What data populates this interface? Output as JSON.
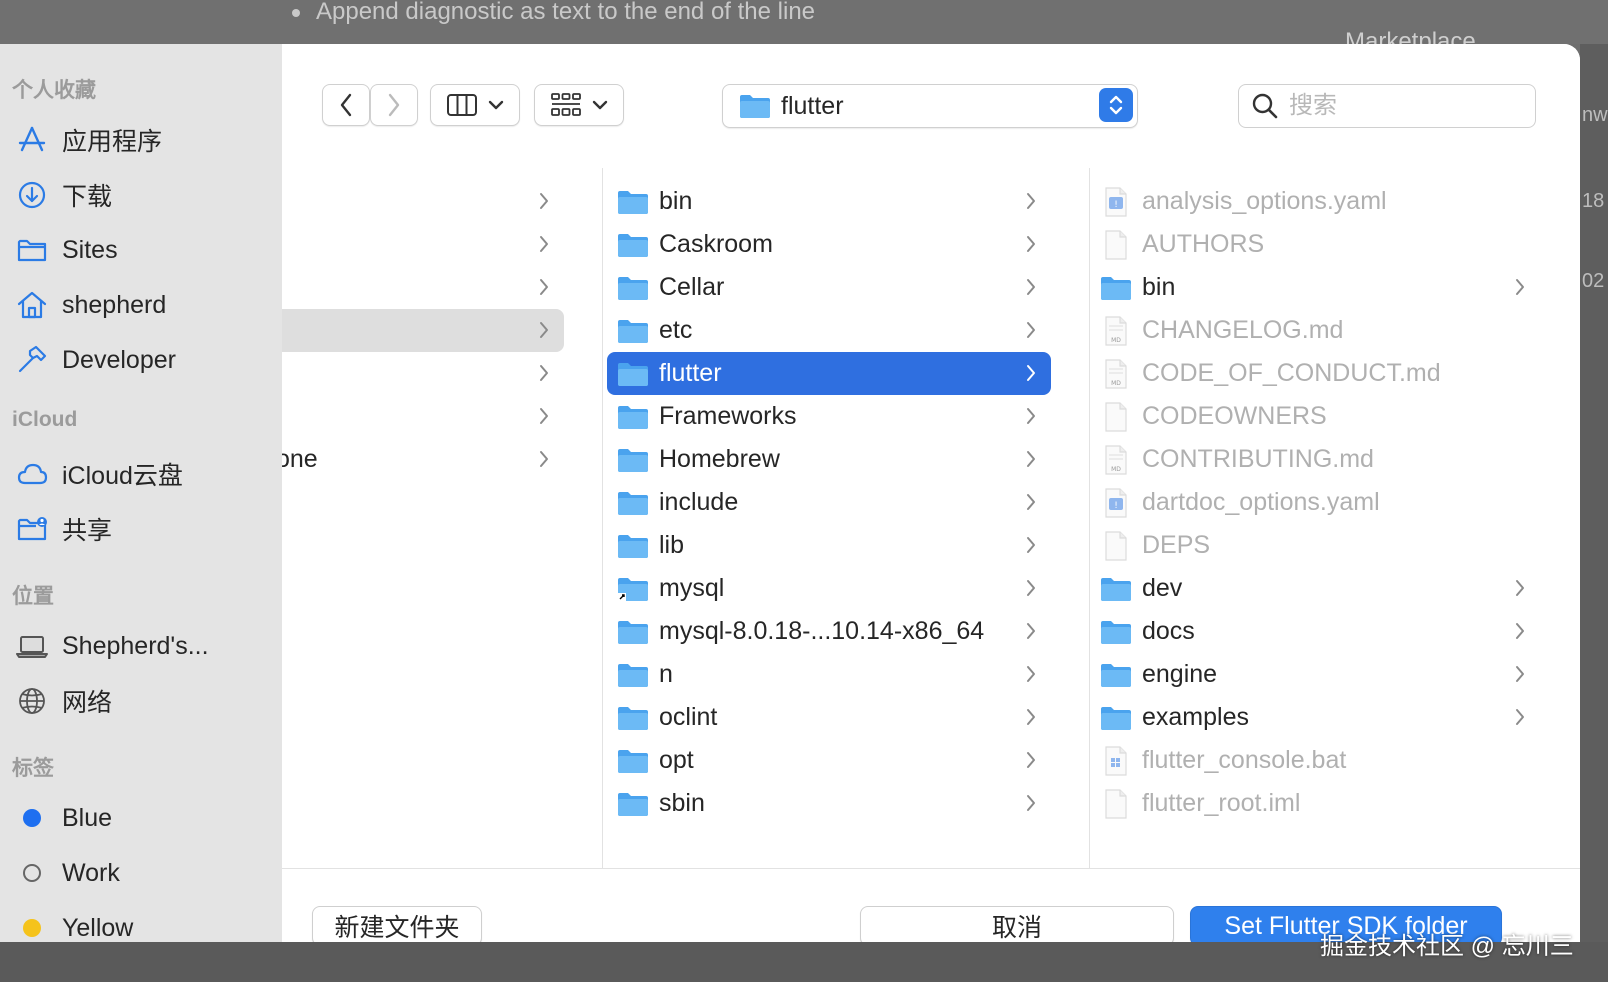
{
  "background": {
    "editor_line": "Append diagnostic as text to the end of the line",
    "marketplace": "Marketplace",
    "right_fragments": [
      "nw",
      "18",
      "02"
    ],
    "watermark": "掘金技术社区 @ 忘川三"
  },
  "sidebar": {
    "sections": [
      {
        "title": "个人收藏",
        "items": [
          {
            "label": "应用程序",
            "icon": "applications-icon"
          },
          {
            "label": "下载",
            "icon": "download-icon"
          },
          {
            "label": "Sites",
            "icon": "folder-icon"
          },
          {
            "label": "shepherd",
            "icon": "home-icon"
          },
          {
            "label": "Developer",
            "icon": "hammer-icon"
          }
        ]
      },
      {
        "title": "iCloud",
        "items": [
          {
            "label": "iCloud云盘",
            "icon": "cloud-icon"
          },
          {
            "label": "共享",
            "icon": "shared-folder-icon"
          }
        ]
      },
      {
        "title": "位置",
        "items": [
          {
            "label": "Shepherd's...",
            "icon": "laptop-icon"
          },
          {
            "label": "网络",
            "icon": "globe-icon"
          }
        ]
      },
      {
        "title": "标签",
        "items": [
          {
            "label": "Blue",
            "icon": "tag-blue-icon",
            "color": "#1e6ff0"
          },
          {
            "label": "Work",
            "icon": "tag-work-icon"
          },
          {
            "label": "Yellow",
            "icon": "tag-yellow-icon",
            "color": "#f5c31b"
          }
        ]
      }
    ]
  },
  "toolbar": {
    "path_folder": "flutter",
    "search_placeholder": "搜索"
  },
  "column1": {
    "partial_label": "one"
  },
  "column2": {
    "items": [
      {
        "label": "bin"
      },
      {
        "label": "Caskroom"
      },
      {
        "label": "Cellar"
      },
      {
        "label": "etc"
      },
      {
        "label": "flutter",
        "selected": true
      },
      {
        "label": "Frameworks"
      },
      {
        "label": "Homebrew"
      },
      {
        "label": "include"
      },
      {
        "label": "lib"
      },
      {
        "label": "mysql",
        "alias": true
      },
      {
        "label": "mysql-8.0.18-...10.14-x86_64"
      },
      {
        "label": "n"
      },
      {
        "label": "oclint"
      },
      {
        "label": "opt"
      },
      {
        "label": "sbin"
      }
    ]
  },
  "column3": {
    "items": [
      {
        "label": "analysis_options.yaml",
        "kind": "yaml"
      },
      {
        "label": "AUTHORS",
        "kind": "doc"
      },
      {
        "label": "bin",
        "kind": "folder"
      },
      {
        "label": "CHANGELOG.md",
        "kind": "md"
      },
      {
        "label": "CODE_OF_CONDUCT.md",
        "kind": "md"
      },
      {
        "label": "CODEOWNERS",
        "kind": "doc"
      },
      {
        "label": "CONTRIBUTING.md",
        "kind": "md"
      },
      {
        "label": "dartdoc_options.yaml",
        "kind": "yaml"
      },
      {
        "label": "DEPS",
        "kind": "doc"
      },
      {
        "label": "dev",
        "kind": "folder"
      },
      {
        "label": "docs",
        "kind": "folder"
      },
      {
        "label": "engine",
        "kind": "folder"
      },
      {
        "label": "examples",
        "kind": "folder"
      },
      {
        "label": "flutter_console.bat",
        "kind": "bat"
      },
      {
        "label": "flutter_root.iml",
        "kind": "doc"
      }
    ]
  },
  "footer": {
    "new_folder": "新建文件夹",
    "cancel": "取消",
    "confirm": "Set Flutter SDK folder"
  },
  "colors": {
    "accent": "#2f6fe0",
    "folder": "#5aaef0"
  }
}
